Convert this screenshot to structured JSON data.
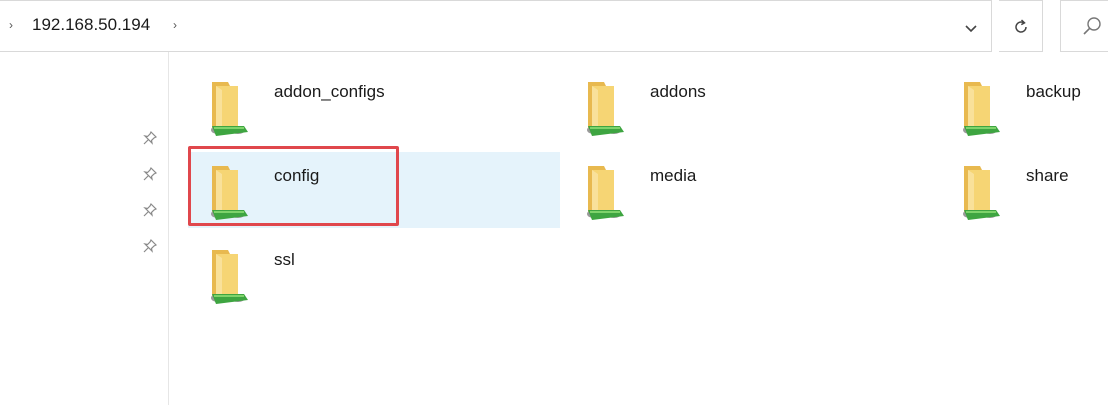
{
  "address_bar": {
    "path": "192.168.50.194",
    "left_chevron": "›",
    "after_chevron": "›"
  },
  "folders": [
    {
      "name": "addon_configs"
    },
    {
      "name": "addons"
    },
    {
      "name": "backup"
    },
    {
      "name": "config",
      "selected": true
    },
    {
      "name": "media"
    },
    {
      "name": "share"
    },
    {
      "name": "ssl"
    }
  ],
  "icons": {
    "dropdown": "chevron-down-icon",
    "refresh": "refresh-icon",
    "search": "search-icon",
    "pin": "pin-icon",
    "folder": "network-folder-icon"
  },
  "colors": {
    "selection_bg": "#e5f3fb",
    "highlight_border": "#e0474c",
    "folder_yellow": "#f3cf6f",
    "network_green": "#3ea541"
  }
}
